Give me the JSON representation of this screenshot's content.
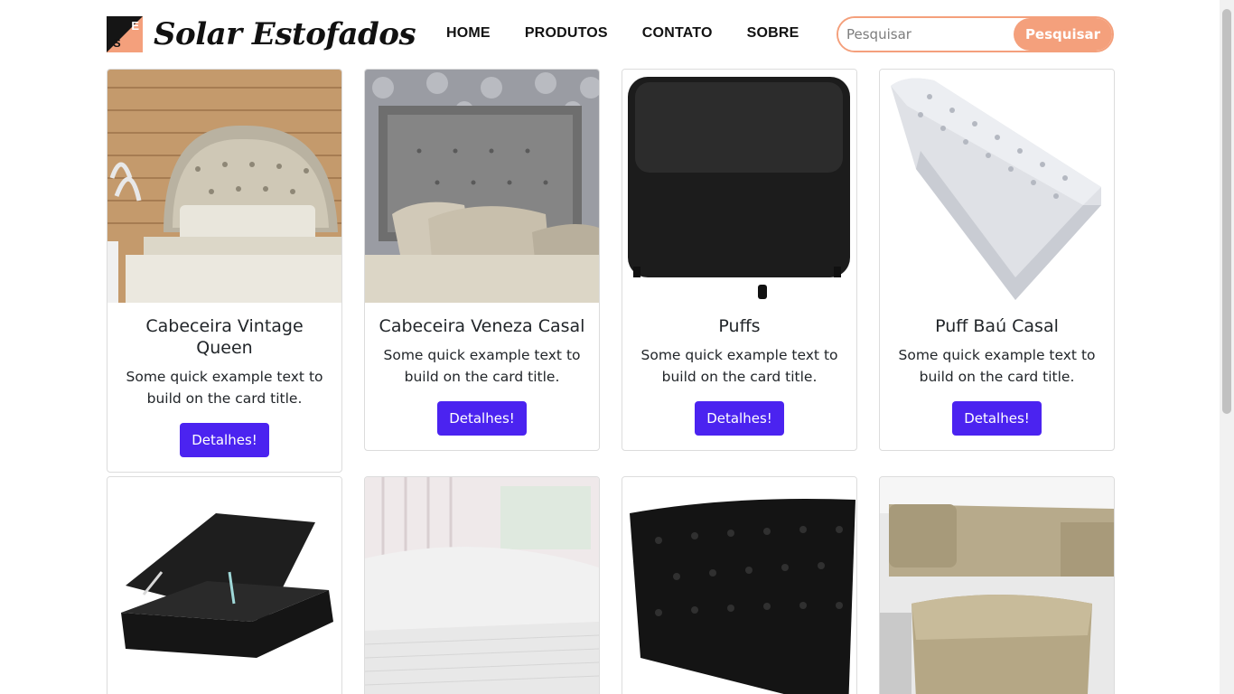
{
  "brand": {
    "logo_letters": [
      "E",
      "S"
    ],
    "name": "Solar Estofados"
  },
  "nav": {
    "items": [
      "HOME",
      "PRODUTOS",
      "CONTATO",
      "SOBRE"
    ]
  },
  "search": {
    "placeholder": "Pesquisar",
    "value": "",
    "button_label": "Pesquisar"
  },
  "colors": {
    "accent": "#f4a07c",
    "button": "#4b23f0"
  },
  "products": [
    {
      "title": "Cabeceira Vintage Queen",
      "text": "Some quick example text to build on the card title.",
      "button": "Detalhes!",
      "image": "tufted-headboard-bed-photo"
    },
    {
      "title": "Cabeceira Veneza Casal",
      "text": "Some quick example text to build on the card title.",
      "button": "Detalhes!",
      "image": "gray-headboard-bed-photo"
    },
    {
      "title": "Puffs",
      "text": "Some quick example text to build on the card title.",
      "button": "Detalhes!",
      "image": "black-cube-pouf-photo"
    },
    {
      "title": "Puff Baú Casal",
      "text": "Some quick example text to build on the card title.",
      "button": "Detalhes!",
      "image": "white-tufted-storage-bench-photo"
    },
    {
      "image": "black-box-bed-storage-photo"
    },
    {
      "image": "white-bed-skirt-photo"
    },
    {
      "image": "black-tufted-headboard-photo"
    },
    {
      "image": "beige-sofa-ottoman-photo"
    }
  ]
}
